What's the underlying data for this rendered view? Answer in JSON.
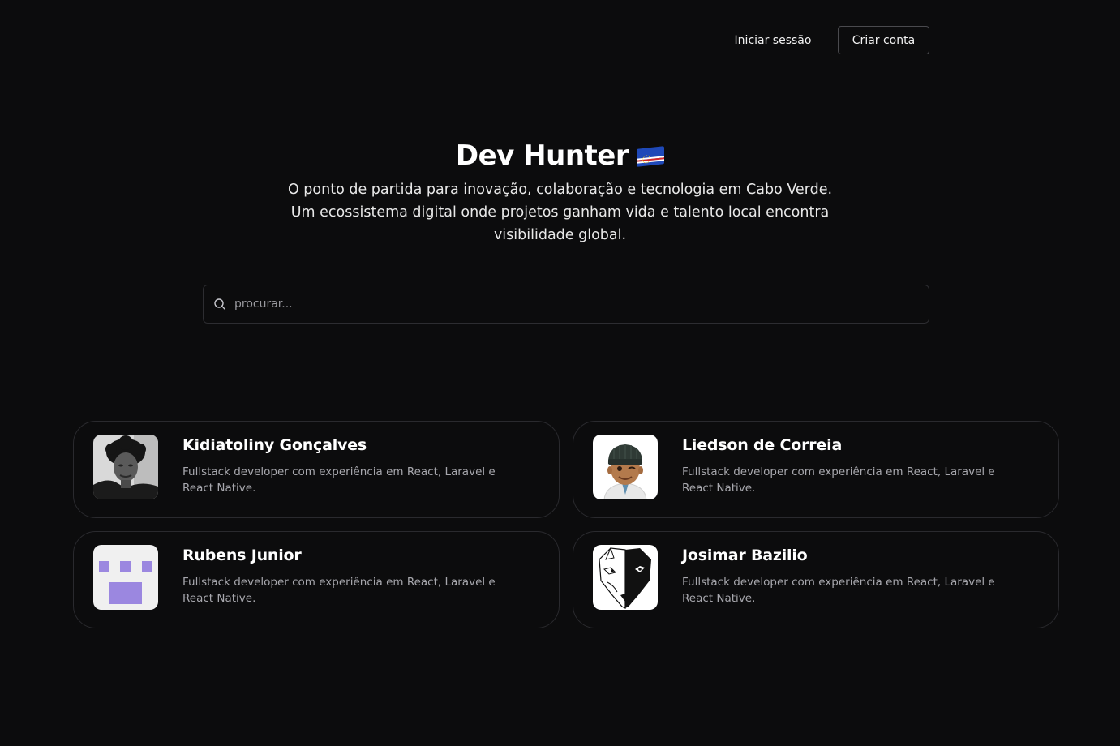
{
  "header": {
    "login_label": "Iniciar sessão",
    "signup_label": "Criar conta"
  },
  "hero": {
    "title": "Dev Hunter",
    "flag_icon": "cape-verde-flag-icon",
    "subtitle": "O ponto de partida para inovação, colaboração e tecnologia em Cabo Verde. Um ecossistema digital onde projetos ganham vida e talento local encontra visibilidade global."
  },
  "search": {
    "placeholder": "procurar...",
    "value": "",
    "icon": "search-icon"
  },
  "developers": [
    {
      "name": "Kidiatoliny Gonçalves",
      "bio": "Fullstack developer com experiência em React, Laravel e React Native.",
      "avatar": "photo-avatar"
    },
    {
      "name": "Liedson de Correia",
      "bio": "Fullstack developer com experiência em React, Laravel e React Native.",
      "avatar": "emoji-avatar"
    },
    {
      "name": "Rubens Junior",
      "bio": "Fullstack developer com experiência em React, Laravel e React Native.",
      "avatar": "identicon-avatar"
    },
    {
      "name": "Josimar Bazilio",
      "bio": "Fullstack developer com experiência em React, Laravel e React Native.",
      "avatar": "wolf-avatar"
    }
  ],
  "colors": {
    "background": "#0c0c0d",
    "border": "#2a2a2e",
    "muted_text": "#a7a7ad",
    "identicon": "#9b87e0"
  }
}
